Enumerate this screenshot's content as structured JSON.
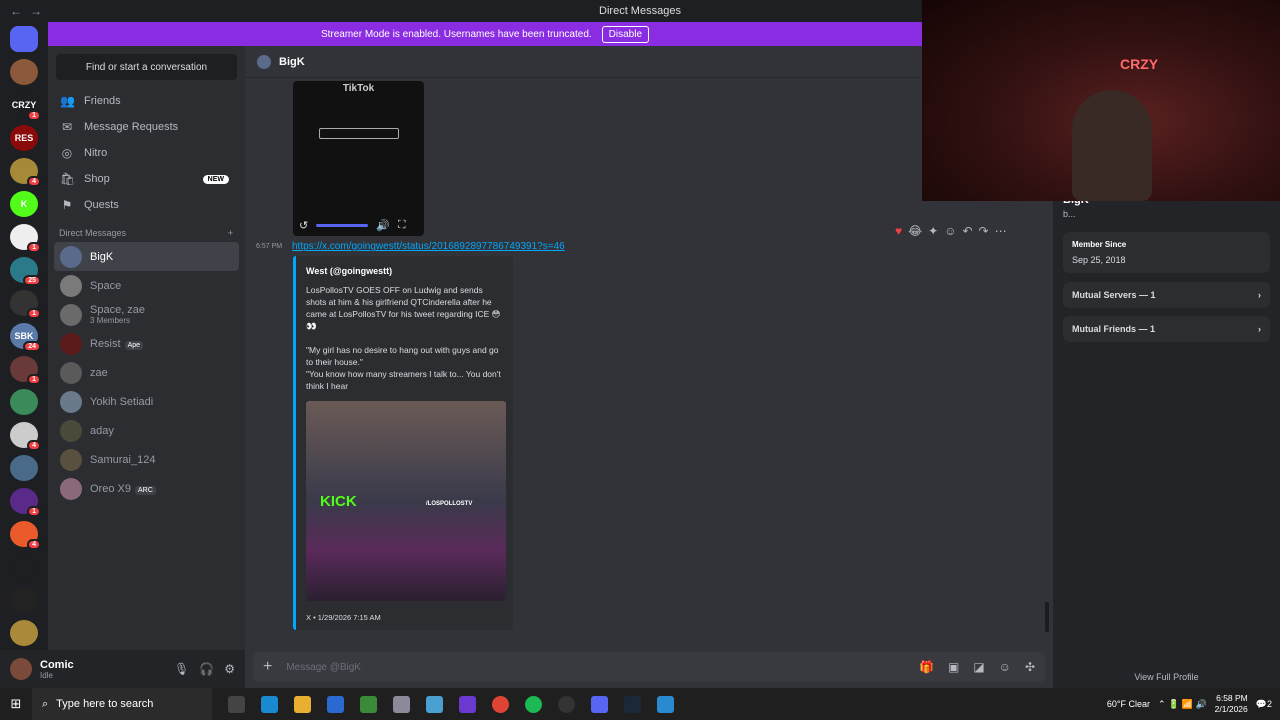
{
  "window": {
    "title": "Direct Messages",
    "back": "←",
    "forward": "→"
  },
  "banner": {
    "text": "Streamer Mode is enabled. Usernames have been truncated.",
    "button": "Disable"
  },
  "guilds": [
    {
      "name": "discord-home",
      "color": "#5865f2",
      "label": "",
      "badge": ""
    },
    {
      "name": "server-1",
      "color": "#8a5a3a",
      "label": "",
      "badge": ""
    },
    {
      "name": "server-crzy",
      "color": "#1e1f22",
      "label": "CRZY",
      "badge": "1"
    },
    {
      "name": "server-res",
      "color": "#8a0a0a",
      "label": "RES",
      "badge": ""
    },
    {
      "name": "server-4",
      "color": "#a58a3a",
      "label": "",
      "badge": "4"
    },
    {
      "name": "server-k",
      "color": "#53fc18",
      "label": "K",
      "badge": ""
    },
    {
      "name": "server-6",
      "color": "#eeeeee",
      "label": "",
      "badge": "1"
    },
    {
      "name": "server-7",
      "color": "#2a7a8a",
      "label": "",
      "badge": "25"
    },
    {
      "name": "server-8",
      "color": "#333",
      "label": "",
      "badge": "1"
    },
    {
      "name": "server-sbk",
      "color": "#5a7aaa",
      "label": "SBK",
      "badge": "24"
    },
    {
      "name": "server-10",
      "color": "#6a3a3a",
      "label": "",
      "badge": "1"
    },
    {
      "name": "server-11",
      "color": "#3a8a5a",
      "label": "",
      "badge": ""
    },
    {
      "name": "server-12",
      "color": "#ccc",
      "label": "",
      "badge": "4"
    },
    {
      "name": "server-13",
      "color": "#4a6a8a",
      "label": "",
      "badge": ""
    },
    {
      "name": "server-14",
      "color": "#5a2a8a",
      "label": "",
      "badge": "1"
    },
    {
      "name": "server-15",
      "color": "#ea5a2a",
      "label": "",
      "badge": "4"
    },
    {
      "name": "server-16",
      "color": "#1e1f22",
      "label": "",
      "badge": ""
    },
    {
      "name": "server-17",
      "color": "#222",
      "label": "",
      "badge": ""
    },
    {
      "name": "server-18",
      "color": "#aa8a3a",
      "label": "",
      "badge": ""
    }
  ],
  "guild_new": "NEW",
  "sidebar": {
    "find": "Find or start a conversation",
    "nav": [
      {
        "label": "Friends",
        "icon": "👥"
      },
      {
        "label": "Message Requests",
        "icon": "✉"
      },
      {
        "label": "Nitro",
        "icon": "◎"
      },
      {
        "label": "Shop",
        "icon": "🛍",
        "tag": "NEW"
      },
      {
        "label": "Quests",
        "icon": "⚑"
      }
    ],
    "dm_header": "Direct Messages",
    "dm_add": "+",
    "dms": [
      {
        "name": "BigK",
        "sub": "",
        "tag": "",
        "color": "#5a6a8a",
        "active": true
      },
      {
        "name": "Space",
        "sub": "",
        "tag": "",
        "color": "#7a7a7a",
        "active": false
      },
      {
        "name": "Space, zae",
        "sub": "3 Members",
        "tag": "",
        "color": "#6a6a6a",
        "active": false
      },
      {
        "name": "Resist",
        "sub": "",
        "tag": "Ape",
        "color": "#5a1a1a",
        "active": false
      },
      {
        "name": "zae",
        "sub": "",
        "tag": "",
        "color": "#5a5a5a",
        "active": false
      },
      {
        "name": "Yokih Setiadi",
        "sub": "",
        "tag": "",
        "color": "#6a7a8a",
        "active": false
      },
      {
        "name": "aday",
        "sub": "",
        "tag": "",
        "color": "#4a4a3a",
        "active": false
      },
      {
        "name": "Samurai_124",
        "sub": "",
        "tag": "",
        "color": "#5a5040",
        "active": false
      },
      {
        "name": "Oreo X9",
        "sub": "",
        "tag": "ARC",
        "color": "#8a6a7a",
        "active": false
      }
    ]
  },
  "user": {
    "name": "Comic",
    "status": "Idle"
  },
  "chat": {
    "recipient": "BigK",
    "video_title": "TikTok",
    "time": "6:57 PM",
    "link": "https://x.com/goingwestt/status/2016892897786749391?s=46",
    "embed": {
      "author": "West (@goingwestt)",
      "description": "LosPollosTV GOES OFF on Ludwig and sends shots at him & his girlfriend QTCinderella after he came at LosPollosTV for his tweet regarding ICE 😳👀\n\n\"My girl has no desire to hang out with guys and go to their house.\"\n\"You know how many streamers I talk to... You don't think I hear",
      "image_text_kick": "KICK",
      "image_text_handle": "/LOSPOLLOSTV",
      "footer": "X • 1/29/2026 7:15 AM"
    },
    "composer_placeholder": "Message @BigK"
  },
  "profile": {
    "name": "BigK",
    "sub": "b...",
    "member_since_label": "Member Since",
    "member_since": "Sep 25, 2018",
    "mutual_servers": "Mutual Servers — 1",
    "mutual_friends": "Mutual Friends — 1",
    "view_full": "View Full Profile",
    "neon": "CRZY"
  },
  "taskbar": {
    "search": "Type here to search",
    "weather": "60°F  Clear",
    "time": "6:58 PM",
    "date": "2/1/2026",
    "notif": "2"
  },
  "colors": {
    "banner": "#8a2ce2",
    "link": "#00a8fc",
    "accent": "#5865f2"
  }
}
